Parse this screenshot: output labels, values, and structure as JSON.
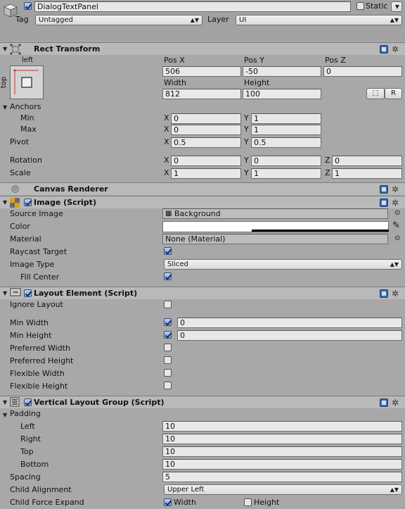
{
  "header": {
    "object_name": "DialogTextPanel",
    "active_checked": true,
    "static_label": "Static",
    "static_checked": false,
    "tag_label": "Tag",
    "tag_value": "Untagged",
    "layer_label": "Layer",
    "layer_value": "UI"
  },
  "rect_transform": {
    "title": "Rect Transform",
    "anchor_h_label": "left",
    "anchor_v_label": "top",
    "pos_x_label": "Pos X",
    "pos_y_label": "Pos Y",
    "pos_z_label": "Pos Z",
    "pos_x": "506",
    "pos_y": "-50",
    "pos_z": "0",
    "width_label": "Width",
    "height_label": "Height",
    "width": "812",
    "height": "100",
    "r_button": "R",
    "anchors_label": "Anchors",
    "min_label": "Min",
    "max_label": "Max",
    "min_x": "0",
    "min_y": "1",
    "max_x": "0",
    "max_y": "1",
    "pivot_label": "Pivot",
    "pivot_x": "0.5",
    "pivot_y": "0.5",
    "rotation_label": "Rotation",
    "rot_x": "0",
    "rot_y": "0",
    "rot_z": "0",
    "scale_label": "Scale",
    "scale_x": "1",
    "scale_y": "1",
    "scale_z": "1",
    "x": "X",
    "y": "Y",
    "z": "Z"
  },
  "canvas_renderer": {
    "title": "Canvas Renderer"
  },
  "image": {
    "title": "Image (Script)",
    "enabled": true,
    "source_image_label": "Source Image",
    "source_image": "Background",
    "color_label": "Color",
    "color_value": "#ffffff",
    "material_label": "Material",
    "material": "None (Material)",
    "raycast_label": "Raycast Target",
    "raycast_checked": true,
    "image_type_label": "Image Type",
    "image_type": "Sliced",
    "fill_center_label": "Fill Center",
    "fill_center_checked": true
  },
  "layout_element": {
    "title": "Layout Element (Script)",
    "enabled": true,
    "ignore_layout_label": "Ignore Layout",
    "ignore_layout": false,
    "min_width_label": "Min Width",
    "min_width_checked": true,
    "min_width": "0",
    "min_height_label": "Min Height",
    "min_height_checked": true,
    "min_height": "0",
    "pref_width_label": "Preferred Width",
    "pref_width_checked": false,
    "pref_height_label": "Preferred Height",
    "pref_height_checked": false,
    "flex_width_label": "Flexible Width",
    "flex_width_checked": false,
    "flex_height_label": "Flexible Height",
    "flex_height_checked": false
  },
  "vertical_layout": {
    "title": "Vertical Layout Group (Script)",
    "enabled": true,
    "padding_label": "Padding",
    "left_label": "Left",
    "left": "10",
    "right_label": "Right",
    "right": "10",
    "top_label": "Top",
    "top": "10",
    "bottom_label": "Bottom",
    "bottom": "10",
    "spacing_label": "Spacing",
    "spacing": "5",
    "child_alignment_label": "Child Alignment",
    "child_alignment": "Upper Left",
    "child_force_label": "Child Force Expand",
    "force_width_label": "Width",
    "force_width_checked": true,
    "force_height_label": "Height",
    "force_height_checked": false
  },
  "colors": {
    "panel_bg": "#a8a8a8",
    "header_bg": "#b9b9b9",
    "field_bg": "#e8e8e8"
  }
}
